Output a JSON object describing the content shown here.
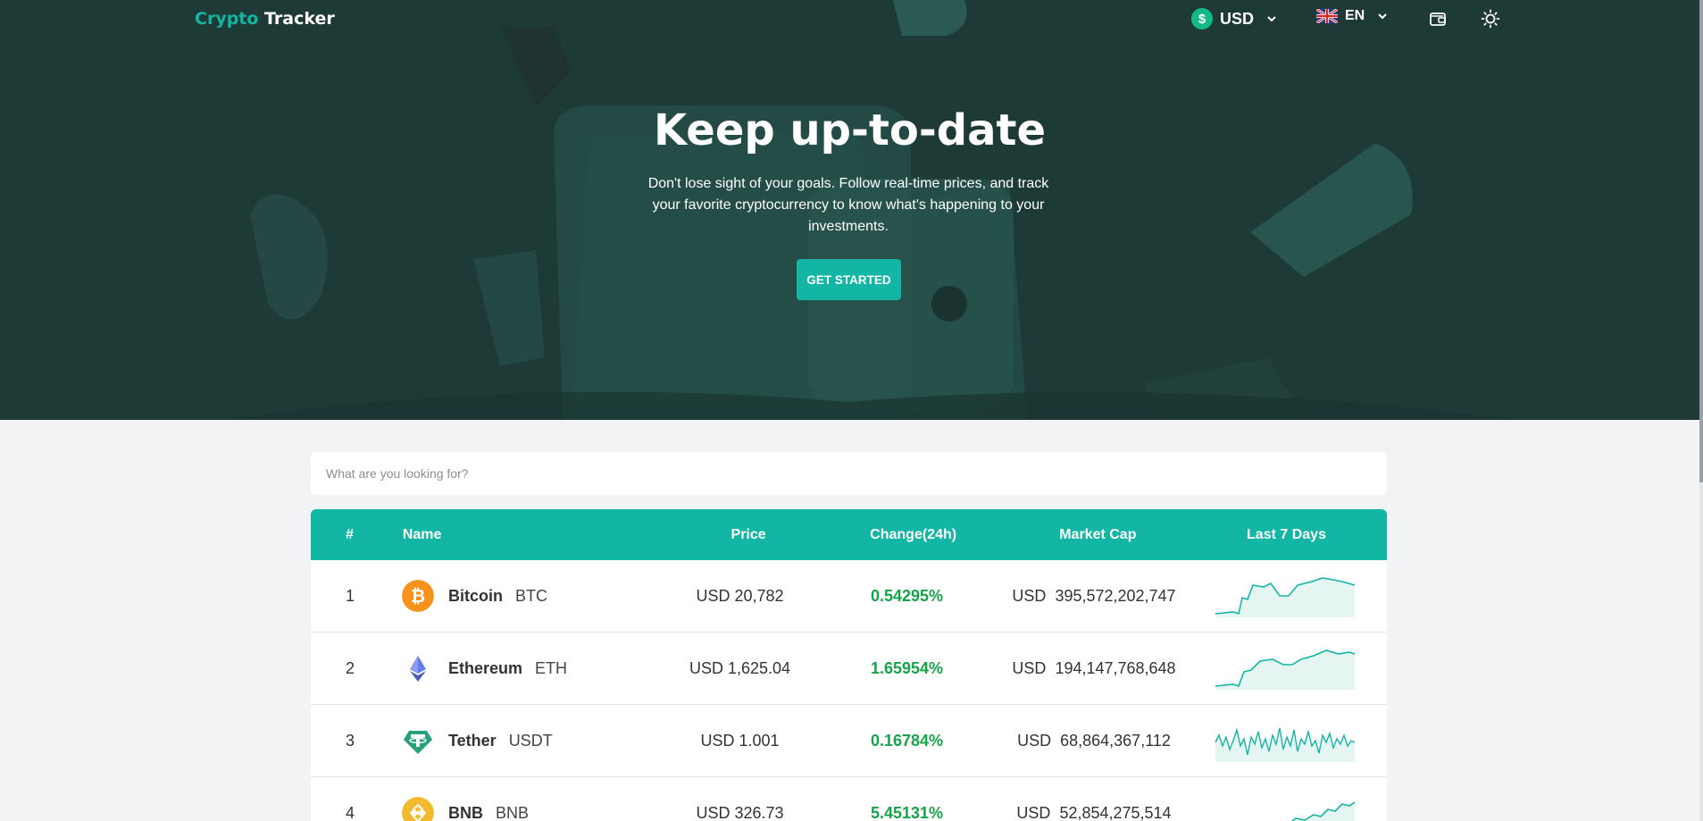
{
  "brand": {
    "part1": "Crypto",
    "part2": " Tracker",
    "accent_color": "#13b5a4"
  },
  "nav": {
    "currency": {
      "label": "USD",
      "icon": "dollar-coin-icon"
    },
    "language": {
      "label": "EN",
      "icon": "uk-flag-icon"
    },
    "wallet_icon": "wallet-icon",
    "theme_icon": "sun-icon"
  },
  "hero": {
    "title": "Keep up-to-date",
    "subtitle": "Don't lose sight of your goals. Follow real-time prices, and track your favorite cryptocurrency to know what's happening to your investments.",
    "cta": "GET STARTED",
    "background_color": "#1d3a36"
  },
  "search": {
    "placeholder": "What are you looking for?"
  },
  "table": {
    "headers": {
      "rank": "#",
      "name": "Name",
      "price": "Price",
      "change": "Change(24h)",
      "market_cap": "Market Cap",
      "last7": "Last 7 Days"
    },
    "rows": [
      {
        "rank": "1",
        "name": "Bitcoin",
        "symbol": "BTC",
        "icon": "bitcoin-icon",
        "price": "USD 20,782",
        "change": "0.54295%",
        "mcap_currency": "USD",
        "mcap": "395,572,202,747"
      },
      {
        "rank": "2",
        "name": "Ethereum",
        "symbol": "ETH",
        "icon": "ethereum-icon",
        "price": "USD 1,625.04",
        "change": "1.65954%",
        "mcap_currency": "USD",
        "mcap": "194,147,768,648"
      },
      {
        "rank": "3",
        "name": "Tether",
        "symbol": "USDT",
        "icon": "tether-icon",
        "price": "USD 1.001",
        "change": "0.16784%",
        "mcap_currency": "USD",
        "mcap": "68,864,367,112"
      },
      {
        "rank": "4",
        "name": "BNB",
        "symbol": "BNB",
        "icon": "bnb-icon",
        "price": "USD 326.73",
        "change": "5.45131%",
        "mcap_currency": "USD",
        "mcap": "52,854,275,514"
      }
    ]
  },
  "colors": {
    "positive": "#16a34a",
    "sparkline": "#13b5a4",
    "header": "#13b5a4"
  }
}
